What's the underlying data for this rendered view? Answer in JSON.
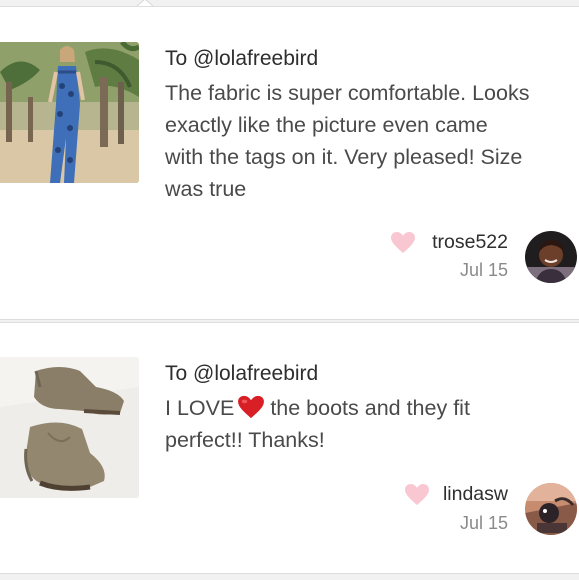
{
  "reviews": [
    {
      "to": "To @lolafreebird",
      "comment_lines": [
        "The fabric is super comfortable. Looks",
        "exactly like the picture even came",
        "with the tags on it. Very pleased! Size",
        "was true"
      ],
      "username": "trose522",
      "date": "Jul 15",
      "thumbnail": "model-jumpsuit-photo",
      "avatar": "user-avatar-photo"
    },
    {
      "to": "To @lolafreebird",
      "comment_before_heart": "I LOVE",
      "comment_heart_icon": "red-heart-emoji",
      "comment_after_heart": "the boots and they fit",
      "comment_line_2": "perfect!! Thanks!",
      "username": "lindasw",
      "date": "Jul 15",
      "thumbnail": "suede-boots-photo",
      "avatar": "user-avatar-photo"
    }
  ],
  "colors": {
    "like_heart": "#f9c7d1",
    "emoji_heart": "#d81f26",
    "background": "#f1f1f1",
    "card": "#ffffff"
  }
}
